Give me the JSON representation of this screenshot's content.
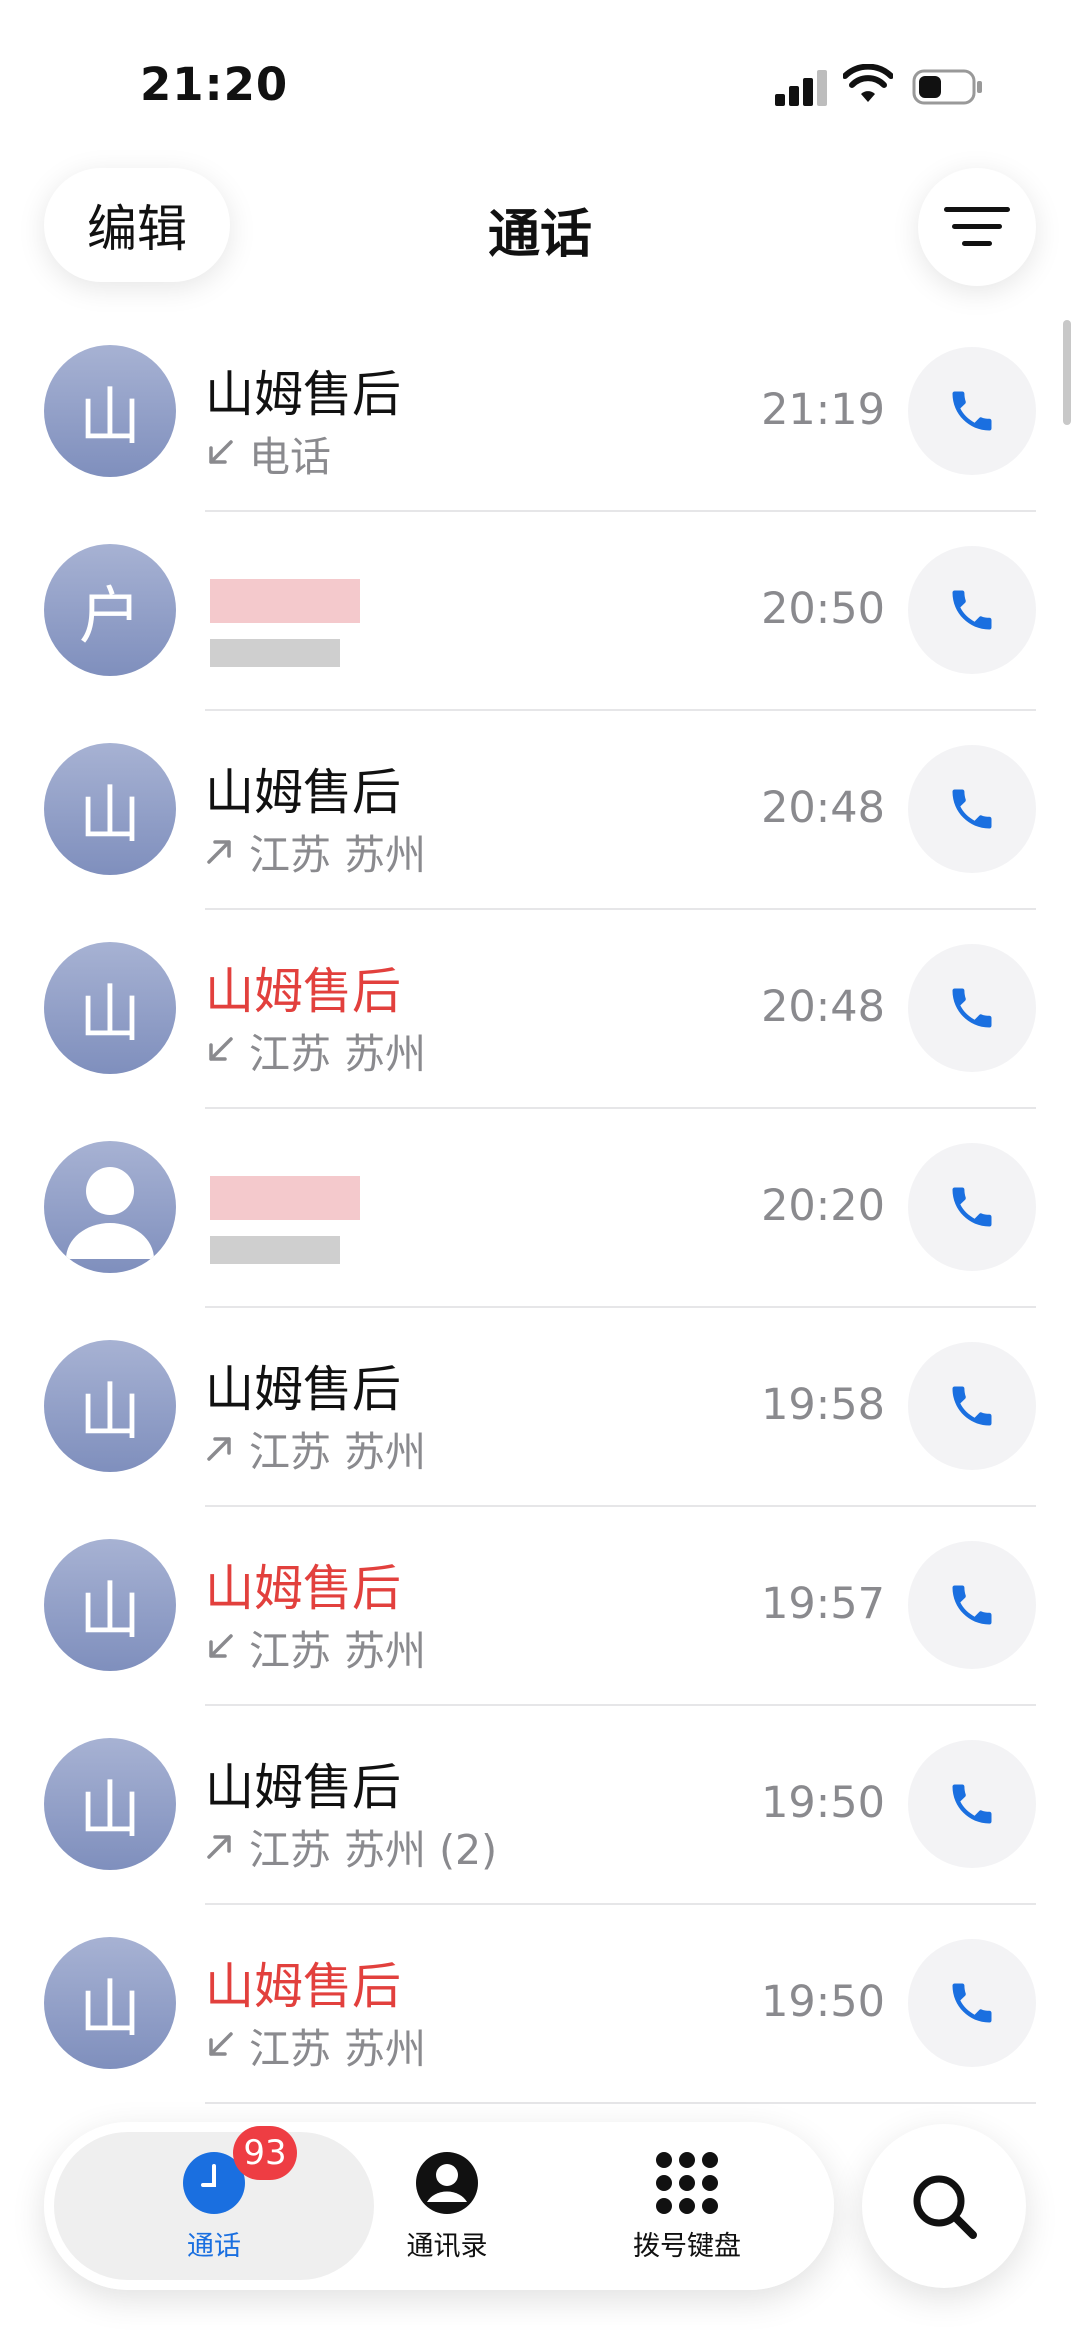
{
  "status_bar": {
    "time": "21:20"
  },
  "header": {
    "edit_label": "编辑",
    "title": "通话"
  },
  "calls": [
    {
      "avatar": "山",
      "name": "山姆售后",
      "missed": false,
      "direction": "incoming",
      "detail": "电话",
      "time": "21:19"
    },
    {
      "avatar": "户",
      "name": "",
      "missed": false,
      "direction": "incoming",
      "detail": "",
      "time": "20:50",
      "redacted": true
    },
    {
      "avatar": "山",
      "name": "山姆售后",
      "missed": false,
      "direction": "outgoing",
      "detail": "江苏 苏州",
      "time": "20:48"
    },
    {
      "avatar": "山",
      "name": "山姆售后",
      "missed": true,
      "direction": "incoming",
      "detail": "江苏 苏州",
      "time": "20:48"
    },
    {
      "avatar": "",
      "name": "",
      "missed": false,
      "direction": "incoming",
      "detail": "",
      "time": "20:20",
      "redacted": true,
      "generic_avatar": true
    },
    {
      "avatar": "山",
      "name": "山姆售后",
      "missed": false,
      "direction": "outgoing",
      "detail": "江苏 苏州",
      "time": "19:58"
    },
    {
      "avatar": "山",
      "name": "山姆售后",
      "missed": true,
      "direction": "incoming",
      "detail": "江苏 苏州",
      "time": "19:57"
    },
    {
      "avatar": "山",
      "name": "山姆售后",
      "missed": false,
      "direction": "outgoing",
      "detail": "江苏 苏州 (2)",
      "time": "19:50"
    },
    {
      "avatar": "山",
      "name": "山姆售后",
      "missed": true,
      "direction": "incoming",
      "detail": "江苏 苏州",
      "time": "19:50"
    }
  ],
  "tabbar": {
    "tabs": [
      {
        "label": "通话",
        "badge": "93",
        "active": true
      },
      {
        "label": "通讯录"
      },
      {
        "label": "拨号键盘"
      }
    ]
  },
  "colors": {
    "accent": "#1a6fe0",
    "missed": "#e2403d",
    "badge": "#ee3d43"
  }
}
